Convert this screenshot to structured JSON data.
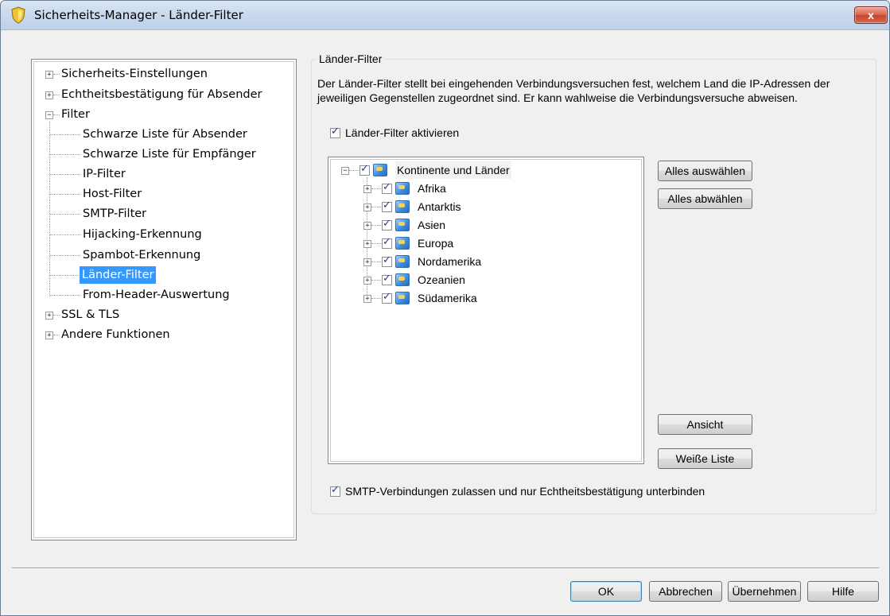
{
  "window": {
    "title": "Sicherheits-Manager - Länder-Filter",
    "close_label": "x"
  },
  "nav": {
    "items": [
      {
        "label": "Sicherheits-Einstellungen",
        "expander": "+"
      },
      {
        "label": "Echtheitsbestätigung für Absender",
        "expander": "+"
      },
      {
        "label": "Filter",
        "expander": "−"
      },
      {
        "label": "Schwarze Liste für Absender"
      },
      {
        "label": "Schwarze Liste für Empfänger"
      },
      {
        "label": "IP-Filter"
      },
      {
        "label": "Host-Filter"
      },
      {
        "label": "SMTP-Filter"
      },
      {
        "label": "Hijacking-Erkennung"
      },
      {
        "label": "Spambot-Erkennung"
      },
      {
        "label": "Länder-Filter",
        "selected": true
      },
      {
        "label": "From-Header-Auswertung"
      },
      {
        "label": "SSL & TLS",
        "expander": "+"
      },
      {
        "label": "Andere Funktionen",
        "expander": "+"
      }
    ]
  },
  "group": {
    "title": "Länder-Filter",
    "description": "Der Länder-Filter stellt bei eingehenden Verbindungsversuchen fest, welchem Land die IP-Adressen der jeweiligen Gegenstellen zugeordnet sind. Er kann wahlweise die Verbindungsversuche abweisen.",
    "enable_label": "Länder-Filter aktivieren",
    "enable_checked": true,
    "smtp_label": "SMTP-Verbindungen zulassen und nur Echtheitsbestätigung unterbinden",
    "smtp_checked": true
  },
  "countries": {
    "root": "Kontinente und Länder",
    "items": [
      "Afrika",
      "Antarktis",
      "Asien",
      "Europa",
      "Nordamerika",
      "Ozeanien",
      "Südamerika"
    ]
  },
  "buttons": {
    "select_all": "Alles auswählen",
    "deselect_all": "Alles abwählen",
    "view": "Ansicht",
    "whitelist": "Weiße Liste",
    "ok": "OK",
    "cancel": "Abbrechen",
    "apply": "Übernehmen",
    "help": "Hilfe"
  },
  "icons": {
    "title": "shield-icon",
    "expand": "plus-expander-icon",
    "collapse": "minus-expander-icon",
    "continent": "globe-icon",
    "check": "checkmark-icon"
  }
}
